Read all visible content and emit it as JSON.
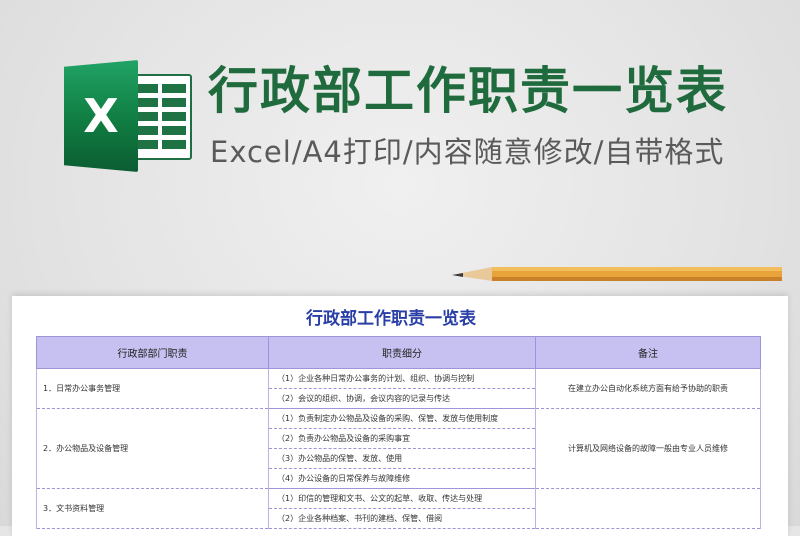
{
  "banner": {
    "title": "行政部工作职责一览表",
    "subtitle": "Excel/A4打印/内容随意修改/自带格式",
    "logo_letter": "X",
    "colors": {
      "title": "#1f6b3d",
      "excel_green": "#107c41",
      "header_fill": "#c6c1f0",
      "doc_title": "#2a3fa6"
    }
  },
  "sheet": {
    "title": "行政部工作职责一览表",
    "headers": [
      "行政部部门职责",
      "职责细分",
      "备注"
    ],
    "groups": [
      {
        "dept": "1．日常办公事务管理",
        "items": [
          "（1）企业各种日常办公事务的计划、组织、协调与控制",
          "（2）会议的组织、协调，会议内容的记录与传达"
        ],
        "note": "在建立办公自动化系统方面有给予协助的职责"
      },
      {
        "dept": "2．办公物品及设备管理",
        "items": [
          "（1）负责制定办公物品及设备的采购、保管、发放与使用制度",
          "（2）负责办公物品及设备的采购事宜",
          "（3）办公物品的保管、发放、使用",
          "（4）办公设备的日常保养与故障维修"
        ],
        "note": "计算机及网络设备的故障一般由专业人员维修"
      },
      {
        "dept": "3．文书资料管理",
        "items": [
          "（1）印信的管理和文书、公文的起草、收取、传达与处理",
          "（2）企业各种档案、书刊的建档、保管、借阅"
        ],
        "note": ""
      }
    ]
  }
}
